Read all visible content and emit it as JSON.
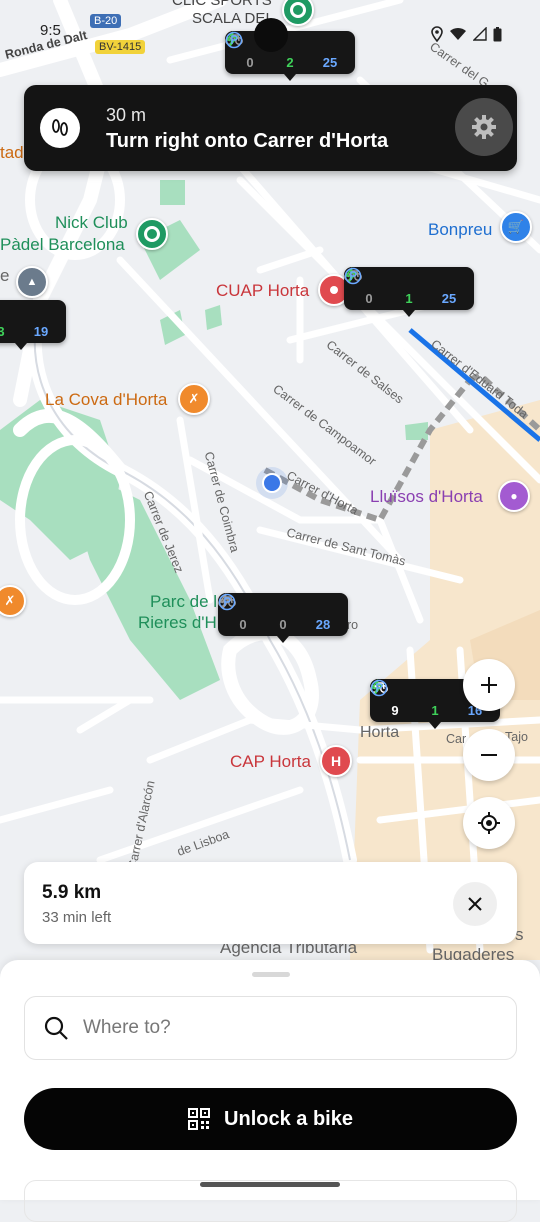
{
  "status_bar": {
    "time": "9:5"
  },
  "navigation": {
    "distance": "30 m",
    "instruction": "Turn right onto Carrer d'Horta",
    "maneuver_icon": "footsteps-icon",
    "settings_icon": "gear-icon"
  },
  "map": {
    "road_badges": [
      "B-20",
      "BV-1415"
    ],
    "streets": [
      "Ronda de Dalt",
      "Carrer del G",
      "Carrer de Salses",
      "Carrer d'Eduard Toda",
      "Carrer de Campoamor",
      "Carrer d'Horta",
      "Carrer de Coimbra",
      "Carrer de Jerez",
      "Carrer de Sant Tomàs",
      "Carrer d'Alarcón",
      "de Lisboa",
      "ero",
      "Car",
      "Horta",
      "Tajo"
    ],
    "pois": {
      "clic_sports": "CLIC SPORTS",
      "scala_dei": "SCALA DEI",
      "tad": "tad",
      "nick_club_line1": "Nick Club",
      "nick_club_line2": "Pàdel Barcelona",
      "bonpreu": "Bonpreu",
      "cuap_horta": "CUAP Horta",
      "la_cova": "La Cova d'Horta",
      "lluisos": "Lluïsos d'Horta",
      "parc_line1": "Parc de l",
      "parc_line2": "Rieres d'H",
      "cap_horta": "CAP Horta",
      "agencia": "Agència Tributària",
      "bugaderes": "Bugaderes",
      "e_fragment": "e",
      "s_fragment": "s"
    },
    "pin_glyphs": {
      "hospital": "H"
    }
  },
  "stations": [
    {
      "bikes": "0",
      "ebikes": "2",
      "docks": "25"
    },
    {
      "bikes": "0",
      "ebikes": "1",
      "docks": "25"
    },
    {
      "ebikes": "3",
      "docks": "19"
    },
    {
      "bikes": "0",
      "ebikes": "0",
      "docks": "28"
    },
    {
      "bikes": "9",
      "ebikes": "1",
      "docks": "16"
    }
  ],
  "map_controls": {
    "zoom_in_icon": "plus-icon",
    "zoom_out_icon": "minus-icon",
    "locate_icon": "crosshair-icon"
  },
  "trip": {
    "distance": "5.9 km",
    "time_left": "33 min left"
  },
  "bottom_sheet": {
    "search_placeholder": "Where to?",
    "unlock_label": "Unlock a bike"
  },
  "colors": {
    "park_green": "#a8dfbf",
    "urban_beige": "#f7e6cc",
    "route_blue": "#1a73e8",
    "station_bg": "#161616",
    "ebike_green": "#3fd15a",
    "dock_blue": "#6aa8ff"
  }
}
